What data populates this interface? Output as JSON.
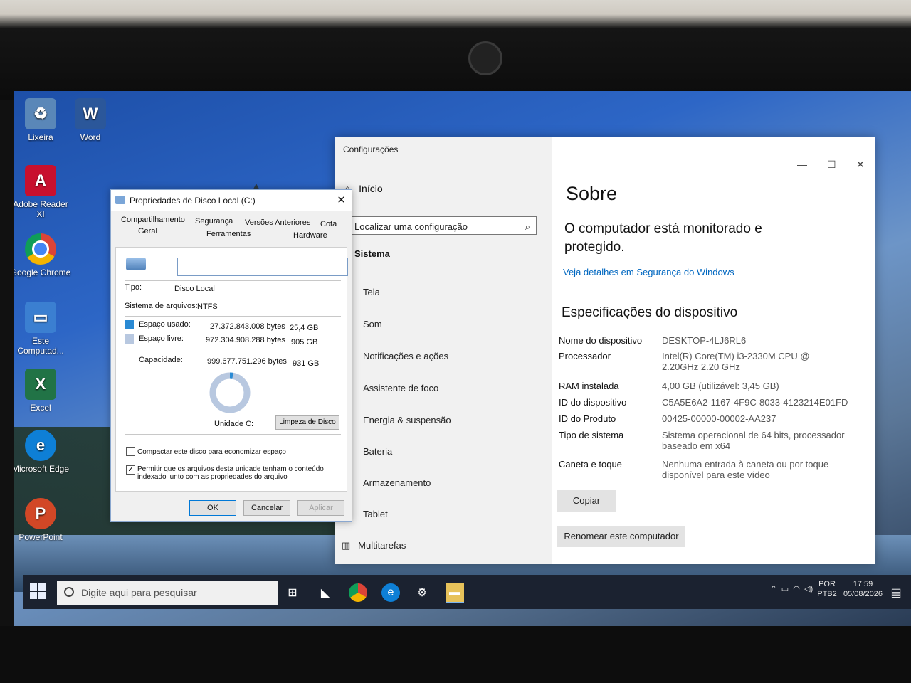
{
  "desktop_icons": [
    {
      "label": "Lixeira",
      "icon": "recycle-bin-icon",
      "color": "#5a87b8"
    },
    {
      "label": "Word",
      "icon": "word-icon",
      "color": "#2b579a"
    },
    {
      "label": "Adobe Reader XI",
      "icon": "adobe-reader-icon",
      "color": "#c8102e"
    },
    {
      "label": "Google Chrome",
      "icon": "chrome-icon",
      "color": "#4285f4"
    },
    {
      "label": "Este Computad...",
      "icon": "computer-icon",
      "color": "#3b7fd1"
    },
    {
      "label": "Excel",
      "icon": "excel-icon",
      "color": "#217346"
    },
    {
      "label": "Microsoft Edge",
      "icon": "edge-icon",
      "color": "#0e7fd6"
    },
    {
      "label": "PowerPoint",
      "icon": "powerpoint-icon",
      "color": "#d24726"
    }
  ],
  "taskbar": {
    "search_placeholder": "Digite aqui para pesquisar",
    "lang_top": "POR",
    "lang_bottom": "PTB2",
    "time": "17:59",
    "date": "05/08/2026"
  },
  "settings": {
    "window_title": "Configurações",
    "home": "Início",
    "search_placeholder": "Localizar uma configuração",
    "section": "Sistema",
    "nav_items": [
      "Tela",
      "Som",
      "Notificações e ações",
      "Assistente de foco",
      "Energia & suspensão",
      "Bateria",
      "Armazenamento",
      "Tablet",
      "Multitarefas"
    ],
    "page_title": "Sobre",
    "protected_text": "O computador está monitorado e protegido.",
    "security_link": "Veja detalhes em Segurança do Windows",
    "specs_title": "Especificações do dispositivo",
    "specs": [
      {
        "key": "Nome do dispositivo",
        "value": "DESKTOP-4LJ6RL6"
      },
      {
        "key": "Processador",
        "value": "Intel(R) Core(TM) i3-2330M CPU @ 2.20GHz 2.20 GHz"
      },
      {
        "key": "RAM instalada",
        "value": "4,00 GB (utilizável: 3,45 GB)"
      },
      {
        "key": "ID do dispositivo",
        "value": "C5A5E6A2-1167-4F9C-8033-4123214E01FD"
      },
      {
        "key": "ID do Produto",
        "value": "00425-00000-00002-AA237"
      },
      {
        "key": "Tipo de sistema",
        "value": "Sistema operacional de 64 bits, processador baseado em x64"
      },
      {
        "key": "Caneta e toque",
        "value": "Nenhuma entrada à caneta ou por toque disponível para este vídeo"
      }
    ],
    "copy_button": "Copiar",
    "rename_button": "Renomear este computador"
  },
  "properties": {
    "title": "Propriedades de Disco Local (C:)",
    "tabs_row1": [
      "Compartilhamento",
      "Segurança",
      "Versões Anteriores",
      "Cota"
    ],
    "tabs_row2": [
      "Geral",
      "Ferramentas",
      "Hardware"
    ],
    "name_value": "",
    "type_label": "Tipo:",
    "type_value": "Disco Local",
    "fs_label": "Sistema de arquivos:",
    "fs_value": "NTFS",
    "used_label": "Espaço usado:",
    "used_bytes": "27.372.843.008 bytes",
    "used_gb": "25,4 GB",
    "free_label": "Espaço livre:",
    "free_bytes": "972.304.908.288 bytes",
    "free_gb": "905 GB",
    "cap_label": "Capacidade:",
    "cap_bytes": "999.677.751.296 bytes",
    "cap_gb": "931 GB",
    "used_fraction": 0.027,
    "used_color": "#2a8ad4",
    "free_color": "#b8c8e0",
    "drive_label": "Unidade C:",
    "cleanup_button": "Limpeza de Disco",
    "compress_label": "Compactar este disco para economizar espaço",
    "compress_checked": false,
    "index_label": "Permitir que os arquivos desta unidade tenham o conteúdo indexado junto com as propriedades do arquivo",
    "index_checked": true,
    "ok_button": "OK",
    "cancel_button": "Cancelar",
    "apply_button": "Aplicar"
  }
}
